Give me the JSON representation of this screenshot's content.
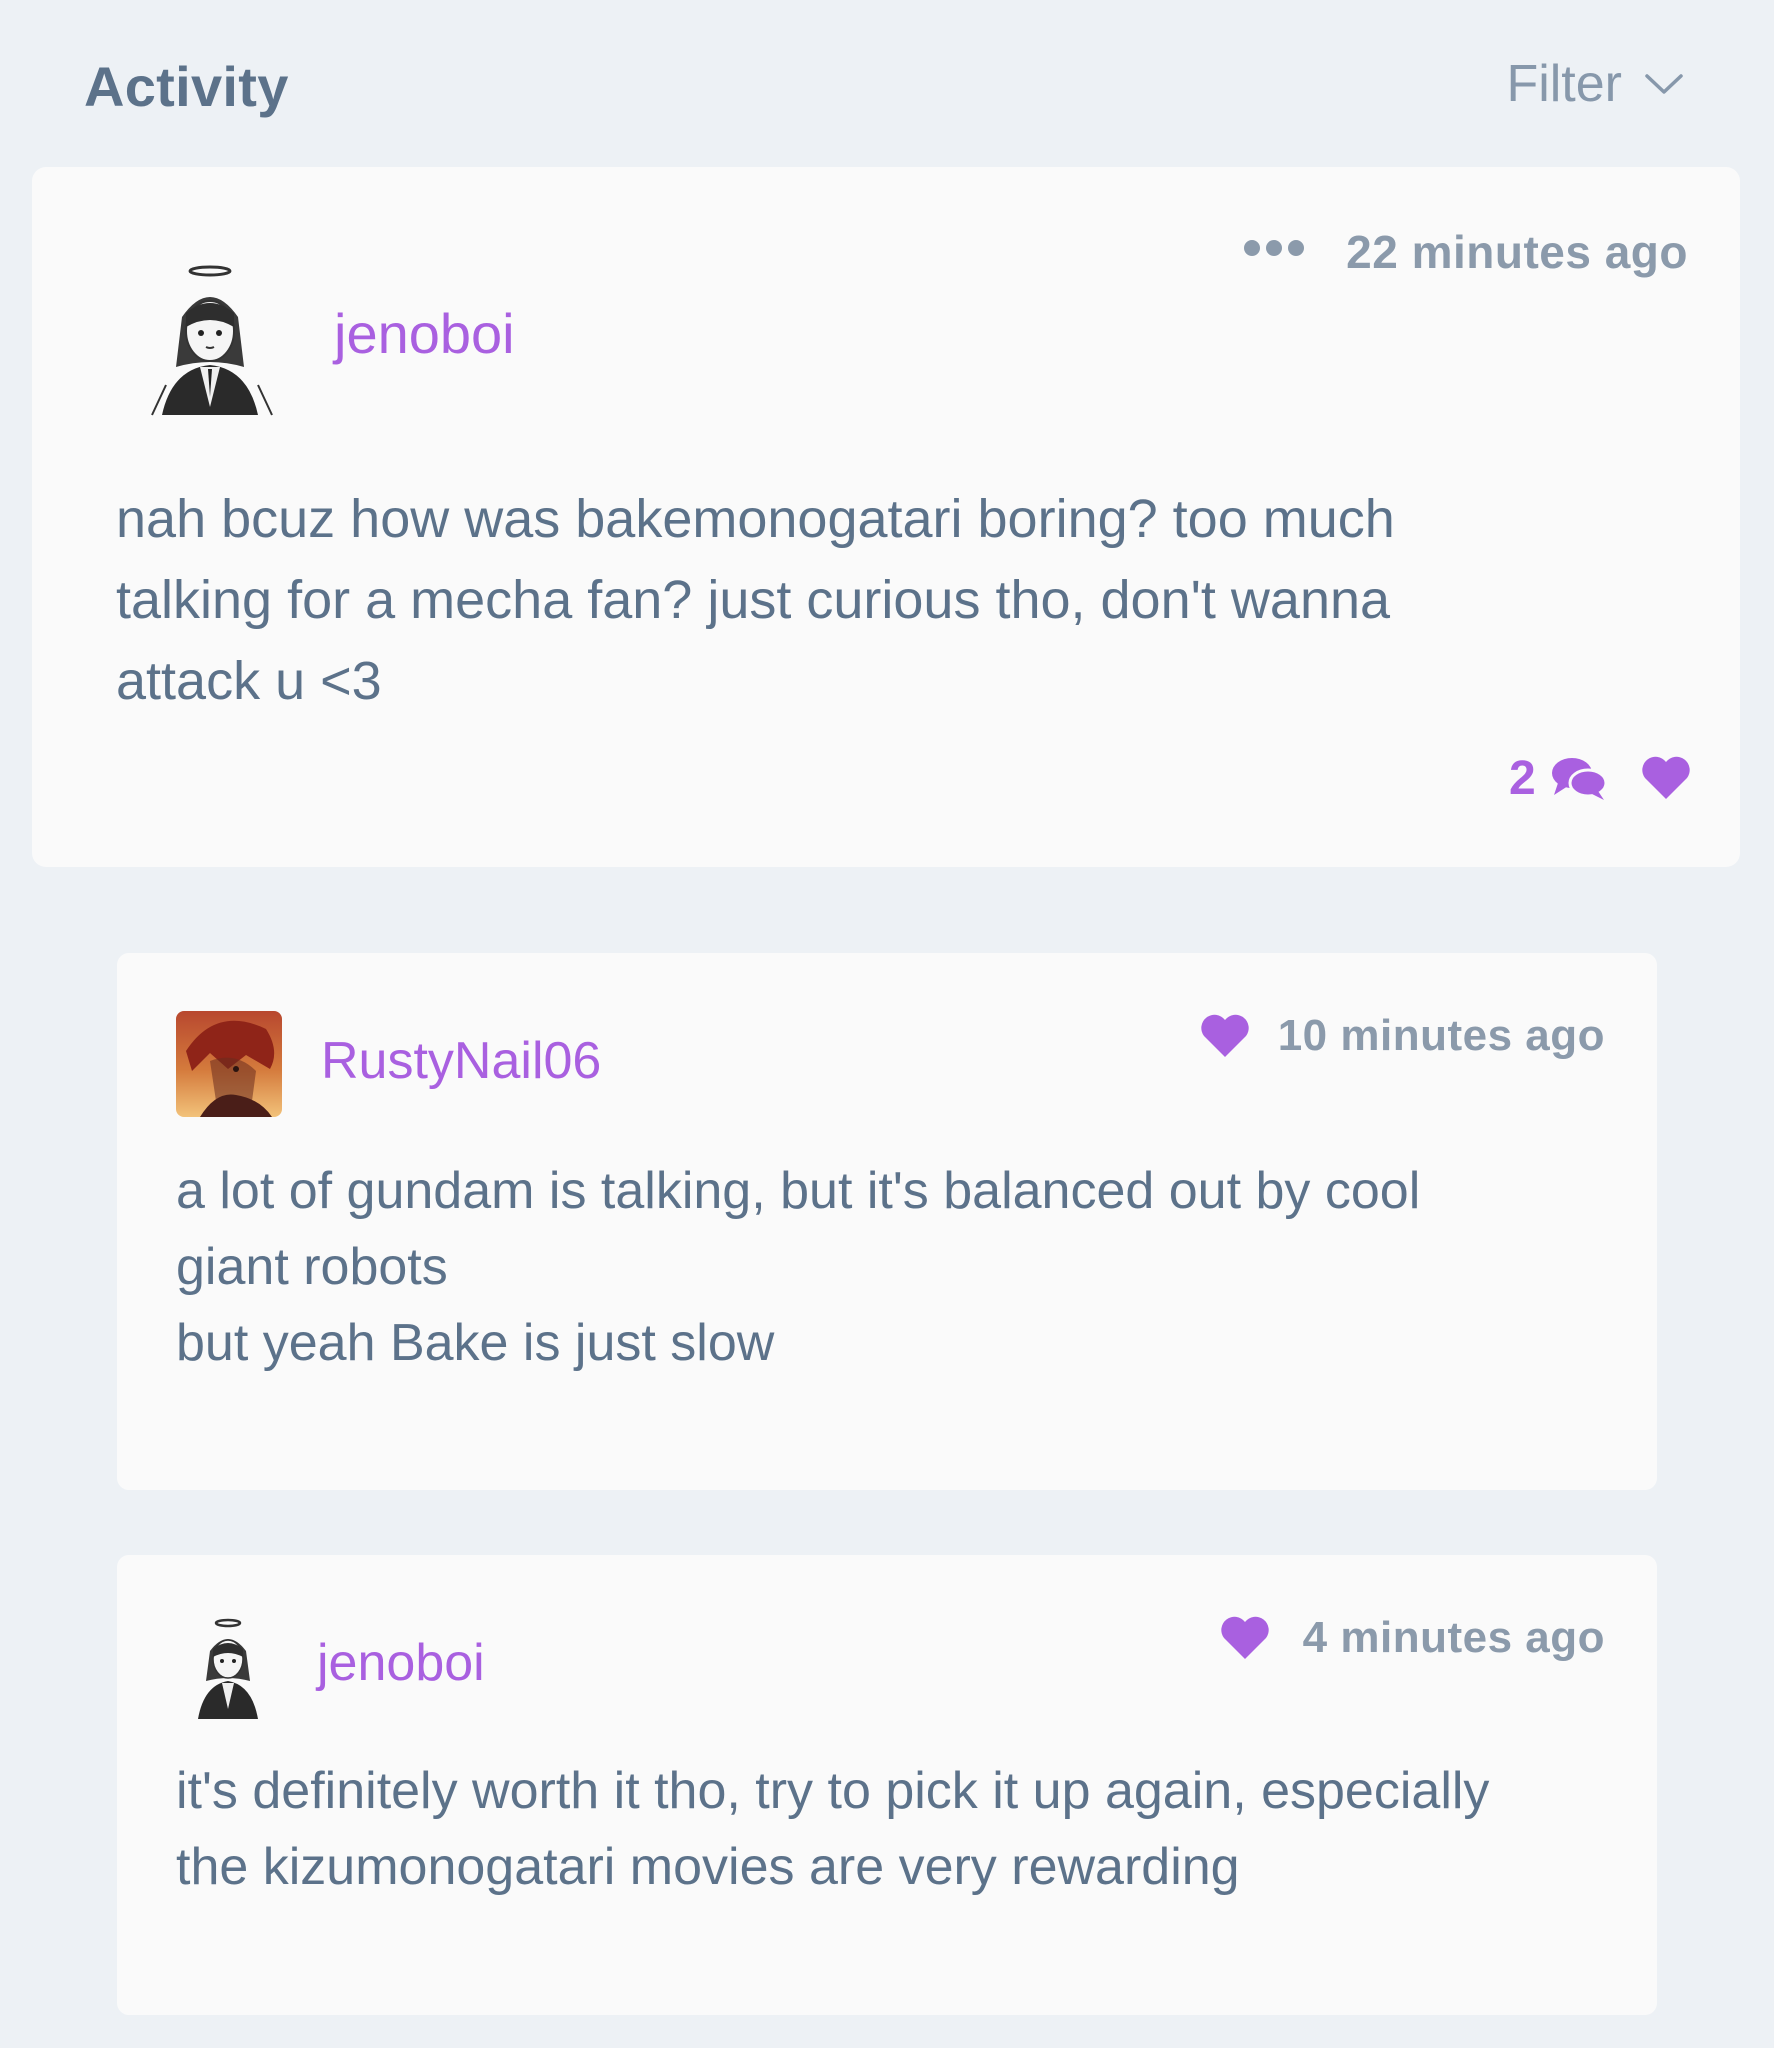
{
  "header": {
    "title": "Activity",
    "filter_label": "Filter",
    "filter_icon": "chevron-down-icon"
  },
  "colors": {
    "background": "#edf1f5",
    "card": "#fafafa",
    "text": "#5c728a",
    "muted": "#8b9aab",
    "accent": "#a960e0"
  },
  "activity": {
    "username": "jenoboi",
    "timestamp": "22 minutes ago",
    "text": "nah bcuz how was bakemonogatari boring? too much\ntalking for a mecha fan? just curious tho, don't wanna\nattack u <3",
    "reply_count": "2",
    "icons": [
      "more-icon",
      "comment-icon",
      "heart-icon"
    ]
  },
  "replies": [
    {
      "username": "RustyNail06",
      "timestamp": "10 minutes ago",
      "text": "a lot of gundam is talking, but it's balanced out by cool\ngiant robots\nbut yeah Bake is just slow"
    },
    {
      "username": "jenoboi",
      "timestamp": "4 minutes ago",
      "text": "it's definitely worth it tho, try to pick it up again, especially\nthe kizumonogatari movies are very rewarding"
    }
  ]
}
